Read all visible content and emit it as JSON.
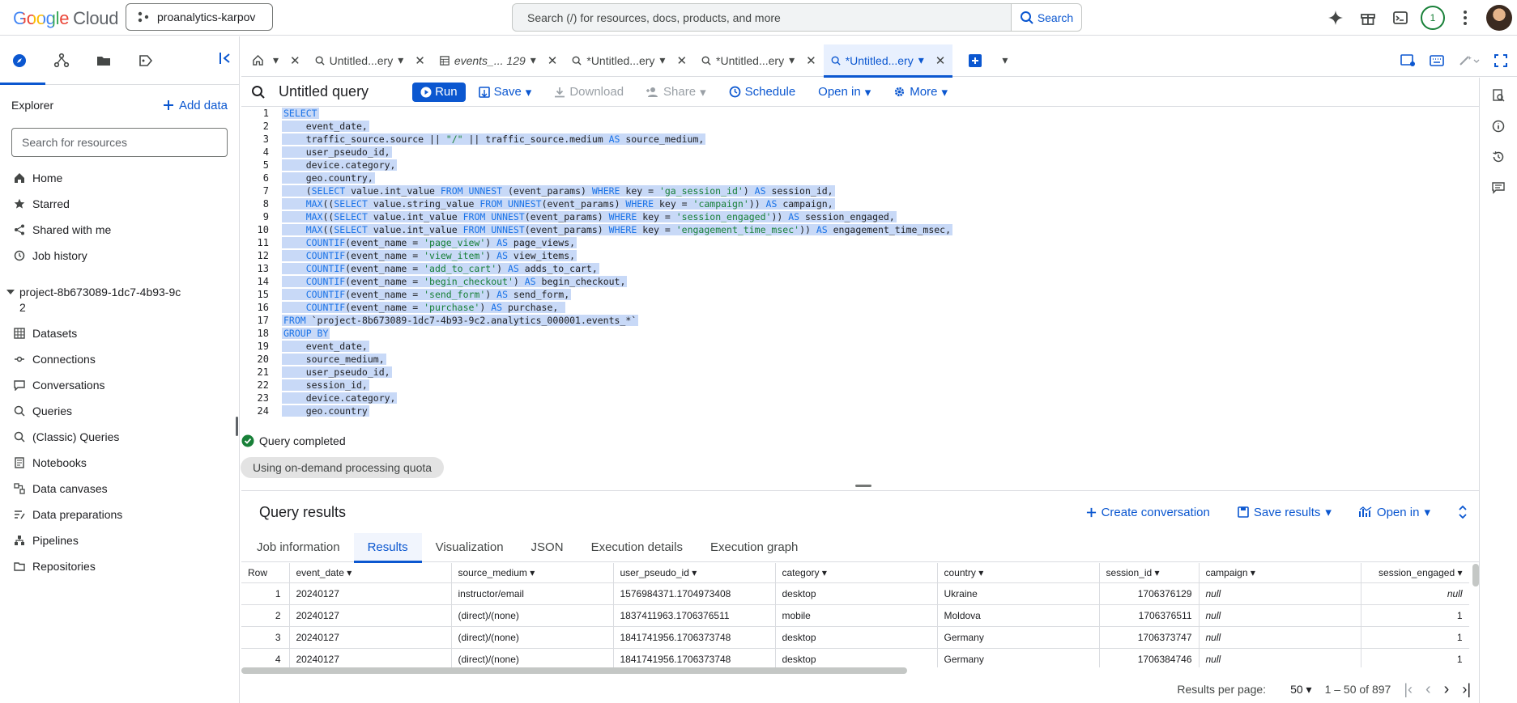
{
  "topbar": {
    "logo_brand": "Google",
    "logo_product": "Cloud",
    "project": "proanalytics-karpov",
    "search_placeholder": "Search (/) for resources, docs, products, and more",
    "search_button": "Search",
    "notification_count": "1"
  },
  "explorer": {
    "title": "Explorer",
    "add_data": "Add data",
    "search_placeholder": "Search for resources",
    "nav": [
      "Home",
      "Starred",
      "Shared with me",
      "Job history"
    ],
    "project_id": "project-8b673089-1dc7-4b93-9c2",
    "project_items": [
      "Datasets",
      "Connections",
      "Conversations",
      "Queries",
      "(Classic) Queries",
      "Notebooks",
      "Data canvases",
      "Data preparations",
      "Pipelines",
      "Repositories"
    ]
  },
  "tabs": [
    {
      "label": "Untitled...ery"
    },
    {
      "label": "events_... 129"
    },
    {
      "label": "*Untitled...ery"
    },
    {
      "label": "*Untitled...ery"
    },
    {
      "label": "*Untitled...ery"
    }
  ],
  "query": {
    "title": "Untitled query",
    "run": "Run",
    "save": "Save",
    "download": "Download",
    "share": "Share",
    "schedule": "Schedule",
    "open_in": "Open in",
    "more": "More",
    "status": "Query completed",
    "quota_chip": "Using on-demand processing quota"
  },
  "results": {
    "title": "Query results",
    "create_conversation": "Create conversation",
    "save_results": "Save results",
    "open_in": "Open in",
    "tabs": [
      "Job information",
      "Results",
      "Visualization",
      "JSON",
      "Execution details",
      "Execution graph"
    ],
    "columns": [
      "Row",
      "event_date",
      "source_medium",
      "user_pseudo_id",
      "category",
      "country",
      "session_id",
      "campaign",
      "session_engaged"
    ],
    "rows": [
      [
        "1",
        "20240127",
        "instructor/email",
        "1576984371.1704973408",
        "desktop",
        "Ukraine",
        "1706376129",
        "null",
        "null"
      ],
      [
        "2",
        "20240127",
        "(direct)/(none)",
        "1837411963.1706376511",
        "mobile",
        "Moldova",
        "1706376511",
        "null",
        "1"
      ],
      [
        "3",
        "20240127",
        "(direct)/(none)",
        "1841741956.1706373748",
        "desktop",
        "Germany",
        "1706373747",
        "null",
        "1"
      ],
      [
        "4",
        "20240127",
        "(direct)/(none)",
        "1841741956.1706373748",
        "desktop",
        "Germany",
        "1706384746",
        "null",
        "1"
      ]
    ],
    "per_page_label": "Results per page:",
    "per_page": "50",
    "range": "1 – 50 of 897"
  }
}
